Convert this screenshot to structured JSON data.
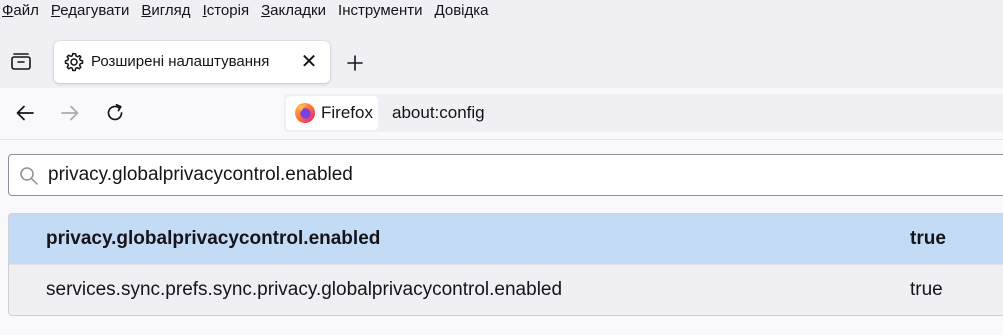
{
  "menubar": {
    "items": [
      {
        "label_u": "Ф",
        "label_rest": "айл"
      },
      {
        "label_u": "Р",
        "label_rest": "едагувати"
      },
      {
        "label_u": "В",
        "label_rest": "игляд"
      },
      {
        "label_u": "І",
        "label_rest": "сторія"
      },
      {
        "label_u": "З",
        "label_rest": "акладки"
      },
      {
        "label_u": "І",
        "label_rest": "нструменти"
      },
      {
        "label_u": "Д",
        "label_rest": "овідка"
      }
    ]
  },
  "tabs": {
    "list_icon": "tab-list-icon",
    "active": {
      "title": "Розширені налаштування",
      "icon": "gear-icon",
      "close": "✕"
    },
    "new_tab_icon": "plus-icon"
  },
  "navbar": {
    "back_icon": "arrow-left-icon",
    "forward_icon": "arrow-right-icon",
    "reload_icon": "reload-icon",
    "identity_label": "Firefox",
    "url": "about:config"
  },
  "search": {
    "value": "privacy.globalprivacycontrol.enabled",
    "icon": "search-icon"
  },
  "prefs": [
    {
      "name": "privacy.globalprivacycontrol.enabled",
      "value": "true",
      "selected": true
    },
    {
      "name": "services.sync.prefs.sync.privacy.globalprivacycontrol.enabled",
      "value": "true",
      "selected": false
    }
  ],
  "colors": {
    "selected_row": "#c4dbf6",
    "row_bg": "#f0f0f4",
    "chrome_bg": "#f0f0f4",
    "text": "#15141a"
  }
}
